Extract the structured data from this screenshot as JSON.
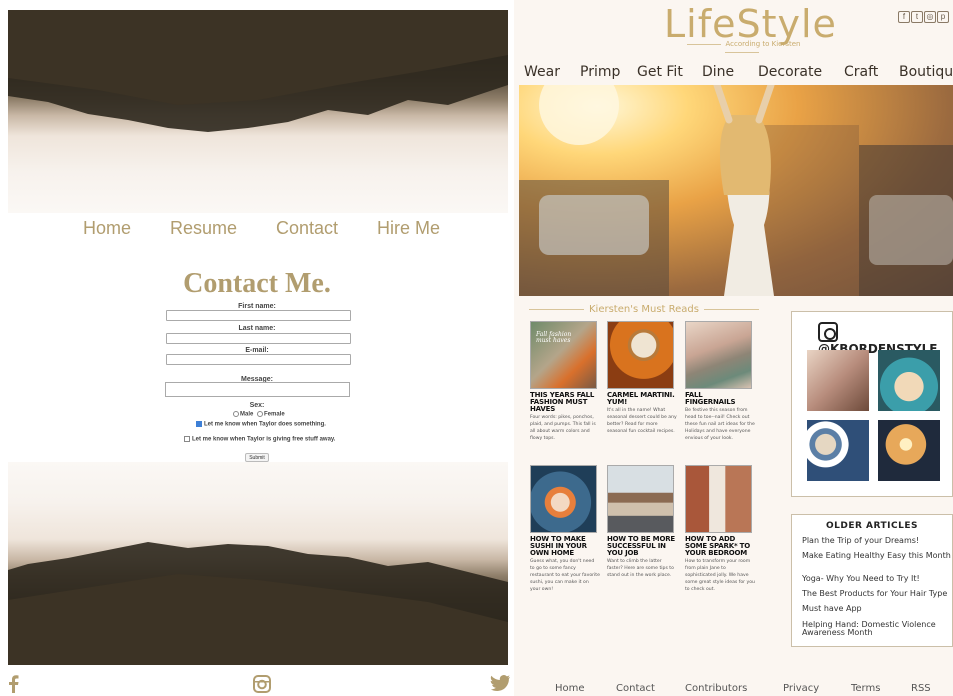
{
  "left": {
    "nav": [
      "Home",
      "Resume",
      "Contact",
      "Hire Me"
    ],
    "title": "Contact Me.",
    "form": {
      "first_name_label": "First name:",
      "last_name_label": "Last name:",
      "email_label": "E-mail:",
      "message_label": "Message:",
      "sex_label": "Sex:",
      "male_label": "Male",
      "female_label": "Female",
      "notify_label": "Let me know when Taylor does something.",
      "notify_checked": true,
      "free_label": "Let me know when Taylor is giving free stuff away.",
      "free_checked": false,
      "submit_label": "Submit"
    },
    "social_icons": [
      "facebook-icon",
      "instagram-icon",
      "twitter-icon"
    ]
  },
  "right": {
    "logo": "LifeStyle",
    "tagline": "According to Kiersten",
    "social_icons": [
      "facebook-icon",
      "twitter-icon",
      "instagram-icon",
      "pinterest-icon"
    ],
    "nav": [
      "Wear",
      "Primp",
      "Get Fit",
      "Dine",
      "Decorate",
      "Craft",
      "Boutique"
    ],
    "must_reads_heading": "Kiersten's Must Reads",
    "posts": [
      {
        "title": "This Years Fall Fashion Must Haves",
        "desc": "Four words: pikes, ponchos, plaid, and pumps. This fall is all about warm colors and flowy tops.",
        "thumb_caption": "Fall fashion must haves"
      },
      {
        "title": "Carmel Martini. Yum!",
        "desc": "It's all in the name! What seasonal dessert could be any better? Read for more seasonal fun cocktail recipes."
      },
      {
        "title": "Fall Fingernails",
        "desc": "Be festive this season from head to toe--nail! Check out these fun nail art ideas for the Holidays and have everyone envious of your look."
      },
      {
        "title": "How to Make Sushi in Your Own Home",
        "desc": "Guess what, you don't need to go to some fancy restaurant to eat your favorite sushi, you can make it on your own!"
      },
      {
        "title": "How to Be More Successful in You Job",
        "desc": "Want to climb the latter faster? Here are some tips to stand out in the work place."
      },
      {
        "title": "How to Add Some Spark* to Your Bedroom",
        "desc": "How to transform your room from plain Jane to sophisticated jolly. We have some great style ideas for you to check out."
      }
    ],
    "instagram_handle": "@KBORDENSTYLE",
    "older_heading": "OLDER ARTICLES",
    "older_articles": [
      "Plan the Trip of your Dreams!",
      "Make Eating Healthy Easy this Month",
      "Yoga- Why You Need to Try It!",
      "The Best Products for Your Hair Type",
      "Must have App",
      "Helping Hand: Domestic Violence Awareness Month"
    ],
    "footer": [
      "Home",
      "Contact",
      "Contributors",
      "Privacy",
      "Terms",
      "RSS"
    ]
  }
}
